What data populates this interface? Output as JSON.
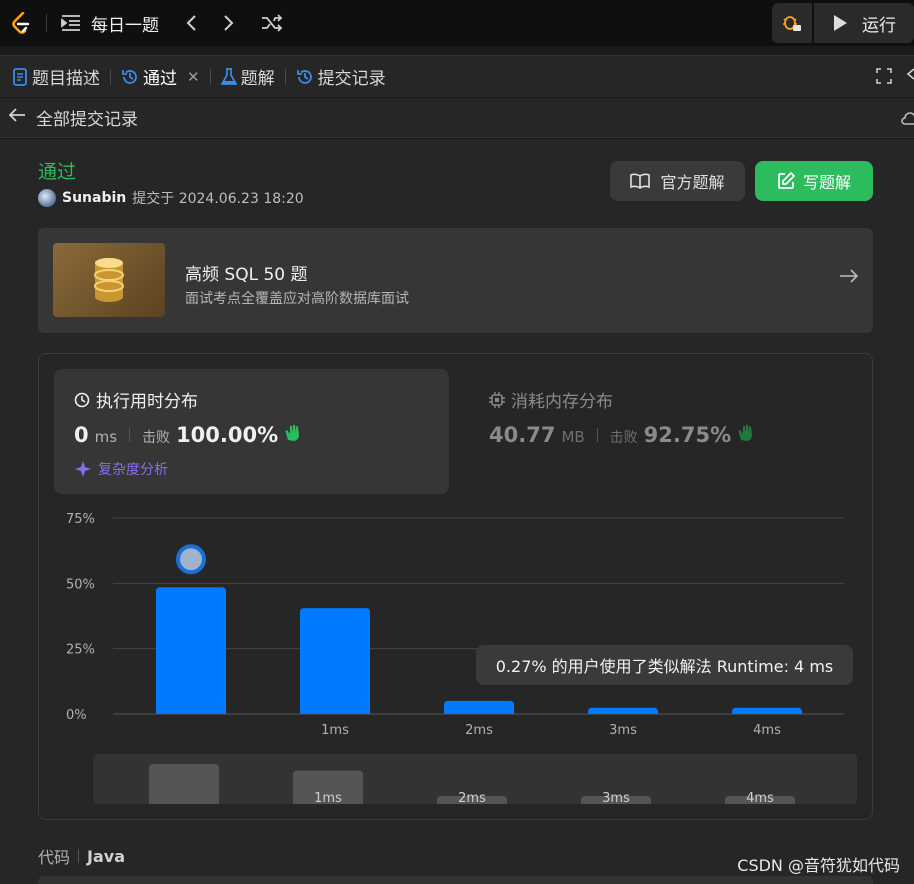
{
  "topbar": {
    "daily_label": "每日一题",
    "run_label": "运行"
  },
  "tabs": [
    {
      "label": "题目描述"
    },
    {
      "label": "通过"
    },
    {
      "label": "题解"
    },
    {
      "label": "提交记录"
    }
  ],
  "subheader": {
    "back_label": "全部提交记录"
  },
  "submission": {
    "status": "通过",
    "username": "Sunabin",
    "submitted_at": "提交于 2024.06.23 18:20",
    "official_solution_label": "官方题解",
    "write_solution_label": "写题解"
  },
  "promo": {
    "title": "高频 SQL 50 题",
    "subtitle": "面试考点全覆盖应对高阶数据库面试"
  },
  "runtime": {
    "title": "执行用时分布",
    "value": "0",
    "unit": "ms",
    "beats_label": "击败",
    "beats_value": "100.00%",
    "complexity_label": "复杂度分析"
  },
  "memory": {
    "title": "消耗内存分布",
    "value": "40.77",
    "unit": "MB",
    "beats_label": "击败",
    "beats_value": "92.75%"
  },
  "chart_data": {
    "type": "bar",
    "categories": [
      "",
      "1ms",
      "2ms",
      "3ms",
      "4ms"
    ],
    "values": [
      48.5,
      40.5,
      5,
      2.4,
      2.4
    ],
    "y_ticks": [
      "0%",
      "25%",
      "50%",
      "75%"
    ],
    "ylim": [
      0,
      75
    ],
    "grid": true,
    "bar_color": "#007aff",
    "highlight_index": 0
  },
  "tooltip": {
    "text": "0.27% 的用户使用了类似解法 Runtime: 4 ms"
  },
  "minimap": {
    "labels": [
      "",
      "1ms",
      "2ms",
      "3ms",
      "4ms"
    ],
    "values": [
      48.5,
      40.5,
      5,
      2.4,
      2.4
    ]
  },
  "code": {
    "label": "代码",
    "language": "Java"
  },
  "watermark": "CSDN @音符犹如代码",
  "colors": {
    "accent_green": "#2cbb5d",
    "bar_blue": "#007aff",
    "complexity_purple": "#8a6cf0"
  }
}
